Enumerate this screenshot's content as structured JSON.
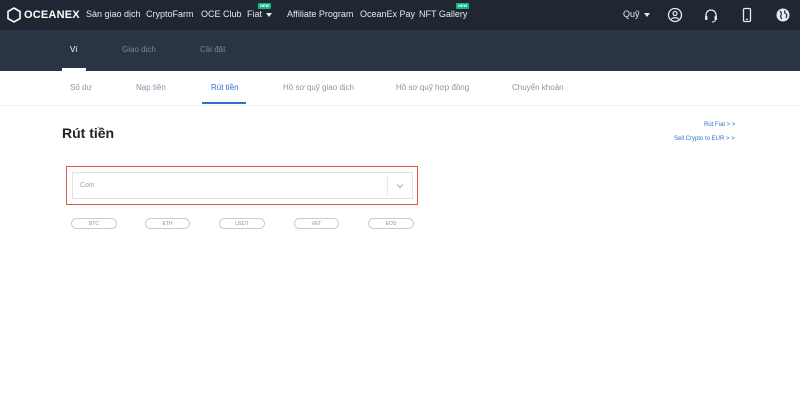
{
  "brand": {
    "name": "OCEANEX"
  },
  "nav": {
    "items": [
      {
        "label": "Sàn giao dịch"
      },
      {
        "label": "CryptoFarm"
      },
      {
        "label": "OCE Club"
      },
      {
        "label": "Fiat",
        "badge": "NEW"
      },
      {
        "label": "Affiliate Program"
      },
      {
        "label": "OceanEx Pay"
      },
      {
        "label": "NFT Gallery",
        "badge": "NEW"
      }
    ],
    "right": {
      "fund_label": "Quỹ"
    }
  },
  "subheader": {
    "tabs": [
      {
        "label": "Ví"
      },
      {
        "label": "Giao dịch"
      },
      {
        "label": "Cài đặt"
      }
    ]
  },
  "tabs": [
    {
      "label": "Số dư"
    },
    {
      "label": "Nạp tiền"
    },
    {
      "label": "Rút tiền"
    },
    {
      "label": "Hồ sơ quỹ giao dịch"
    },
    {
      "label": "Hồ sơ quỹ hợp đồng"
    },
    {
      "label": "Chuyển khoản"
    }
  ],
  "main": {
    "title": "Rút tiền",
    "links": {
      "withdraw_fiat": "Rút Fiat > >",
      "sell_crypto": "Sell Crypto to EUR > >"
    },
    "coin_select": {
      "placeholder": "Coin"
    },
    "quick_coins": [
      "BTC",
      "ETH",
      "USDT",
      "VET",
      "EOS"
    ]
  },
  "colors": {
    "topbar": "#1f2733",
    "subheader": "#2a3444",
    "accent": "#2f6fd0",
    "highlight_border": "#e2574c",
    "badge": "#10b981"
  }
}
